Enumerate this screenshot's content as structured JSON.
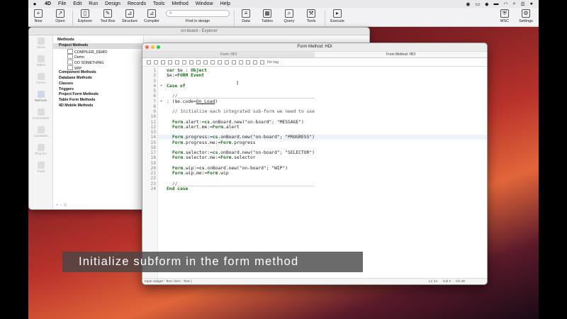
{
  "menubar": {
    "apple": "",
    "items": [
      "4D",
      "File",
      "Edit",
      "Run",
      "Design",
      "Records",
      "Tools",
      "Method",
      "Window",
      "Help"
    ],
    "right_icons": [
      "record-icon",
      "airplay-icon",
      "dropbox-icon",
      "battery-icon",
      "wifi-icon",
      "search-icon",
      "control-center-icon",
      "siri-icon"
    ]
  },
  "toolbar": {
    "new": "New",
    "open": "Open",
    "explorer": "Explorer",
    "toolbox": "Tool Box",
    "structure": "Structure",
    "compiler": "Compiler",
    "find_label": "Find in design",
    "data": "Data",
    "tables": "Tables",
    "query": "Query",
    "tools": "Tools",
    "execute": "Execute",
    "msc": "MSC",
    "settings": "Settings"
  },
  "explorer": {
    "title": "on-board - Explorer",
    "sidebar": [
      "Home",
      "Tables",
      "Forms",
      "Methods",
      "Commands",
      "Constants",
      "Plug-ins",
      "Trash"
    ],
    "methods_header": "Methods",
    "tree": [
      {
        "label": "Project Methods",
        "bold": true,
        "selected": true,
        "child": false
      },
      {
        "label": "COMPILER_DEMO",
        "bold": false,
        "selected": false,
        "child": true
      },
      {
        "label": "Demo",
        "bold": false,
        "selected": false,
        "child": true
      },
      {
        "label": "DO SOMETHING",
        "bold": false,
        "selected": false,
        "child": true
      },
      {
        "label": "WIP",
        "bold": false,
        "selected": false,
        "child": true
      },
      {
        "label": "Component Methods",
        "bold": true,
        "selected": false,
        "child": false
      },
      {
        "label": "Database Methods",
        "bold": true,
        "selected": false,
        "child": false
      },
      {
        "label": "Classes",
        "bold": true,
        "selected": false,
        "child": false
      },
      {
        "label": "Triggers",
        "bold": true,
        "selected": false,
        "child": false
      },
      {
        "label": "Project Form Methods",
        "bold": true,
        "selected": false,
        "child": false
      },
      {
        "label": "Table Form Methods",
        "bold": true,
        "selected": false,
        "child": false
      },
      {
        "label": "4D Mobile Methods",
        "bold": true,
        "selected": false,
        "child": false
      }
    ],
    "footer": "+ − ⊙"
  },
  "form_method": {
    "title": "Form Method: HDI",
    "tabs": [
      "Form: HDI",
      "Form Method: HDI"
    ],
    "no_tag": "No tag",
    "code": [
      {
        "n": "1",
        "indent": 0,
        "html": "<span class='kw'>var</span> $e : <span class='kw'>Object</span>"
      },
      {
        "n": "2",
        "indent": 0,
        "html": "$e:=<span class='kw'>FORM Event</span>"
      },
      {
        "n": "3",
        "indent": 0,
        "html": ""
      },
      {
        "n": "4",
        "indent": 0,
        "html": "<span class='kw'>Case of</span>"
      },
      {
        "n": "5",
        "indent": 0,
        "html": ""
      },
      {
        "n": "6",
        "indent": 1,
        "html": "<span class='cm'>//___________________________________________________</span>"
      },
      {
        "n": "7",
        "indent": 0,
        "html": ": ($e.code=<span class='ul'>On Load</span>)"
      },
      {
        "n": "8",
        "indent": 0,
        "html": ""
      },
      {
        "n": "9",
        "indent": 1,
        "html": "<span class='cm'>// Initialize each integrated sub-form we need to use</span>"
      },
      {
        "n": "10",
        "indent": 0,
        "html": ""
      },
      {
        "n": "11",
        "indent": 1,
        "html": "<span class='kw'>Form</span>.alert:=<span class='kw'>cs</span>.onBoard.new(\"on-board\"; \"MESSAGE\")"
      },
      {
        "n": "12",
        "indent": 1,
        "html": "<span class='kw'>Form</span>.alert.me:=<span class='kw'>Form</span>.alert"
      },
      {
        "n": "13",
        "indent": 0,
        "html": ""
      },
      {
        "n": "14",
        "indent": 1,
        "html": "<span class='kw'>Form</span>.progress:=<span class='kw'>cs</span>.onBoard.new(\"on-board\"; \"PROGRESS\")"
      },
      {
        "n": "15",
        "indent": 1,
        "html": "<span class='kw'>Form</span>.progress.me:=<span class='kw'>Form</span>.progress"
      },
      {
        "n": "16",
        "indent": 0,
        "html": ""
      },
      {
        "n": "17",
        "indent": 1,
        "html": "<span class='kw'>Form</span>.selector:=<span class='kw'>cs</span>.onBoard.new(\"on-board\"; \"SELECTOR\")"
      },
      {
        "n": "18",
        "indent": 1,
        "html": "<span class='kw'>Form</span>.selector.me:=<span class='kw'>Form</span>.selector"
      },
      {
        "n": "19",
        "indent": 0,
        "html": ""
      },
      {
        "n": "20",
        "indent": 1,
        "html": "<span class='kw'>Form</span>.wip:=<span class='kw'>cs</span>.onBoard.new(\"on-board\"; \"WIP\")"
      },
      {
        "n": "21",
        "indent": 1,
        "html": "<span class='kw'>Form</span>.wip.me:=<span class='kw'>Form</span>.wip"
      },
      {
        "n": "22",
        "indent": 0,
        "html": ""
      },
      {
        "n": "23",
        "indent": 1,
        "html": "<span class='cm'>//___________________________________________________</span>"
      },
      {
        "n": "24",
        "indent": 0,
        "html": "<span class='kw'>End case</span>"
      }
    ],
    "highlight_line": 14,
    "status_left": "Input widget : Text; form : Text )",
    "status_line": "Ln 14",
    "status_col": "Col 2",
    "status_ch": "Ch 49"
  },
  "caption": "Initialize subform in the form method"
}
